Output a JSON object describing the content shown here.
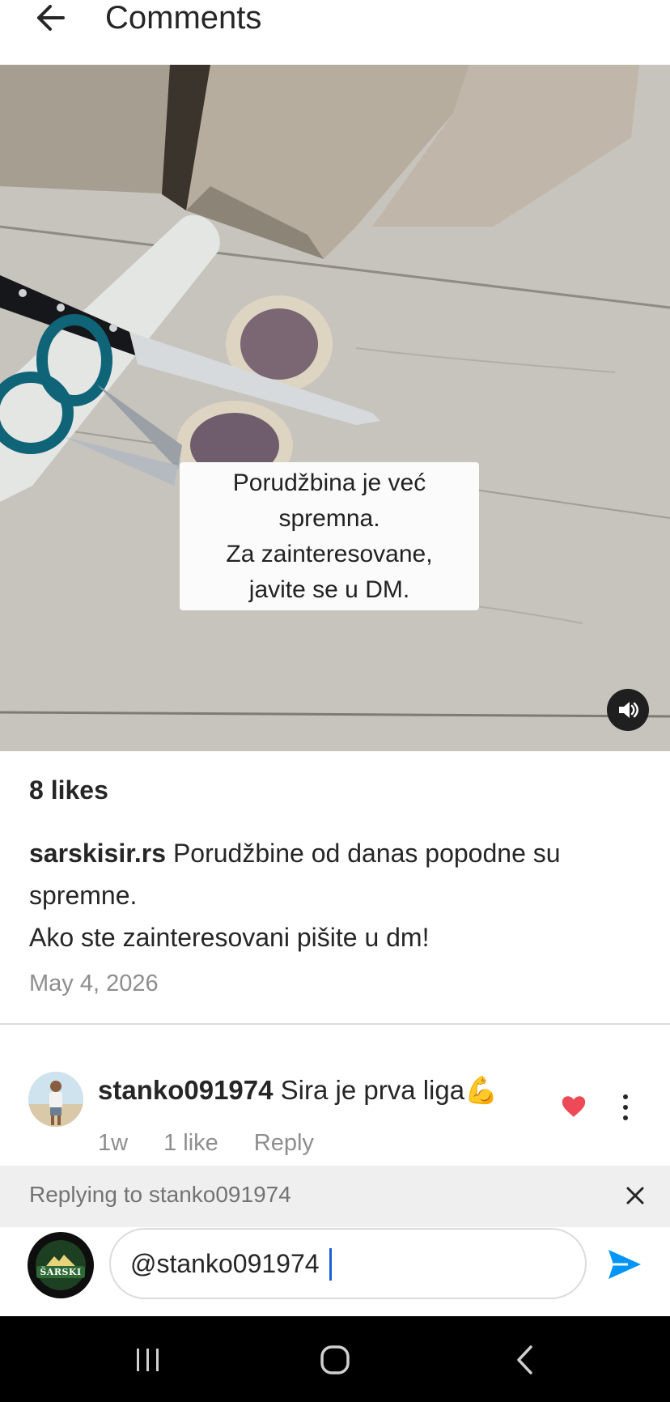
{
  "header": {
    "title": "Comments",
    "back_icon": "arrow-left-icon"
  },
  "media": {
    "overlay_text": "Porudžbina je već\nspremna.\nZa zainteresovane,\njavite se u DM.",
    "sound_icon": "volume-on-icon"
  },
  "post": {
    "likes": "8 likes",
    "username": "sarskisir.rs",
    "caption_line1": "Porudžbine od danas popodne su spremne.",
    "caption_line2": "Ako ste zainteresovani pišite u dm!",
    "date": "May 4, 2026"
  },
  "comment": {
    "username": "stanko091974",
    "text": "Sira je prva liga💪",
    "age": "1w",
    "likes": "1 like",
    "reply_label": "Reply",
    "liked": true,
    "heart_color": "#ed4956"
  },
  "reply_bar": {
    "label": "Replying to stanko091974",
    "close_icon": "close-icon"
  },
  "composer": {
    "value": "@stanko091974",
    "avatar_logo_text": "ŠARSKI",
    "send_icon": "send-icon",
    "send_color": "#0095f6"
  },
  "system_nav": {
    "recents_icon": "recents-icon",
    "home_icon": "home-icon",
    "back_icon": "back-icon"
  }
}
